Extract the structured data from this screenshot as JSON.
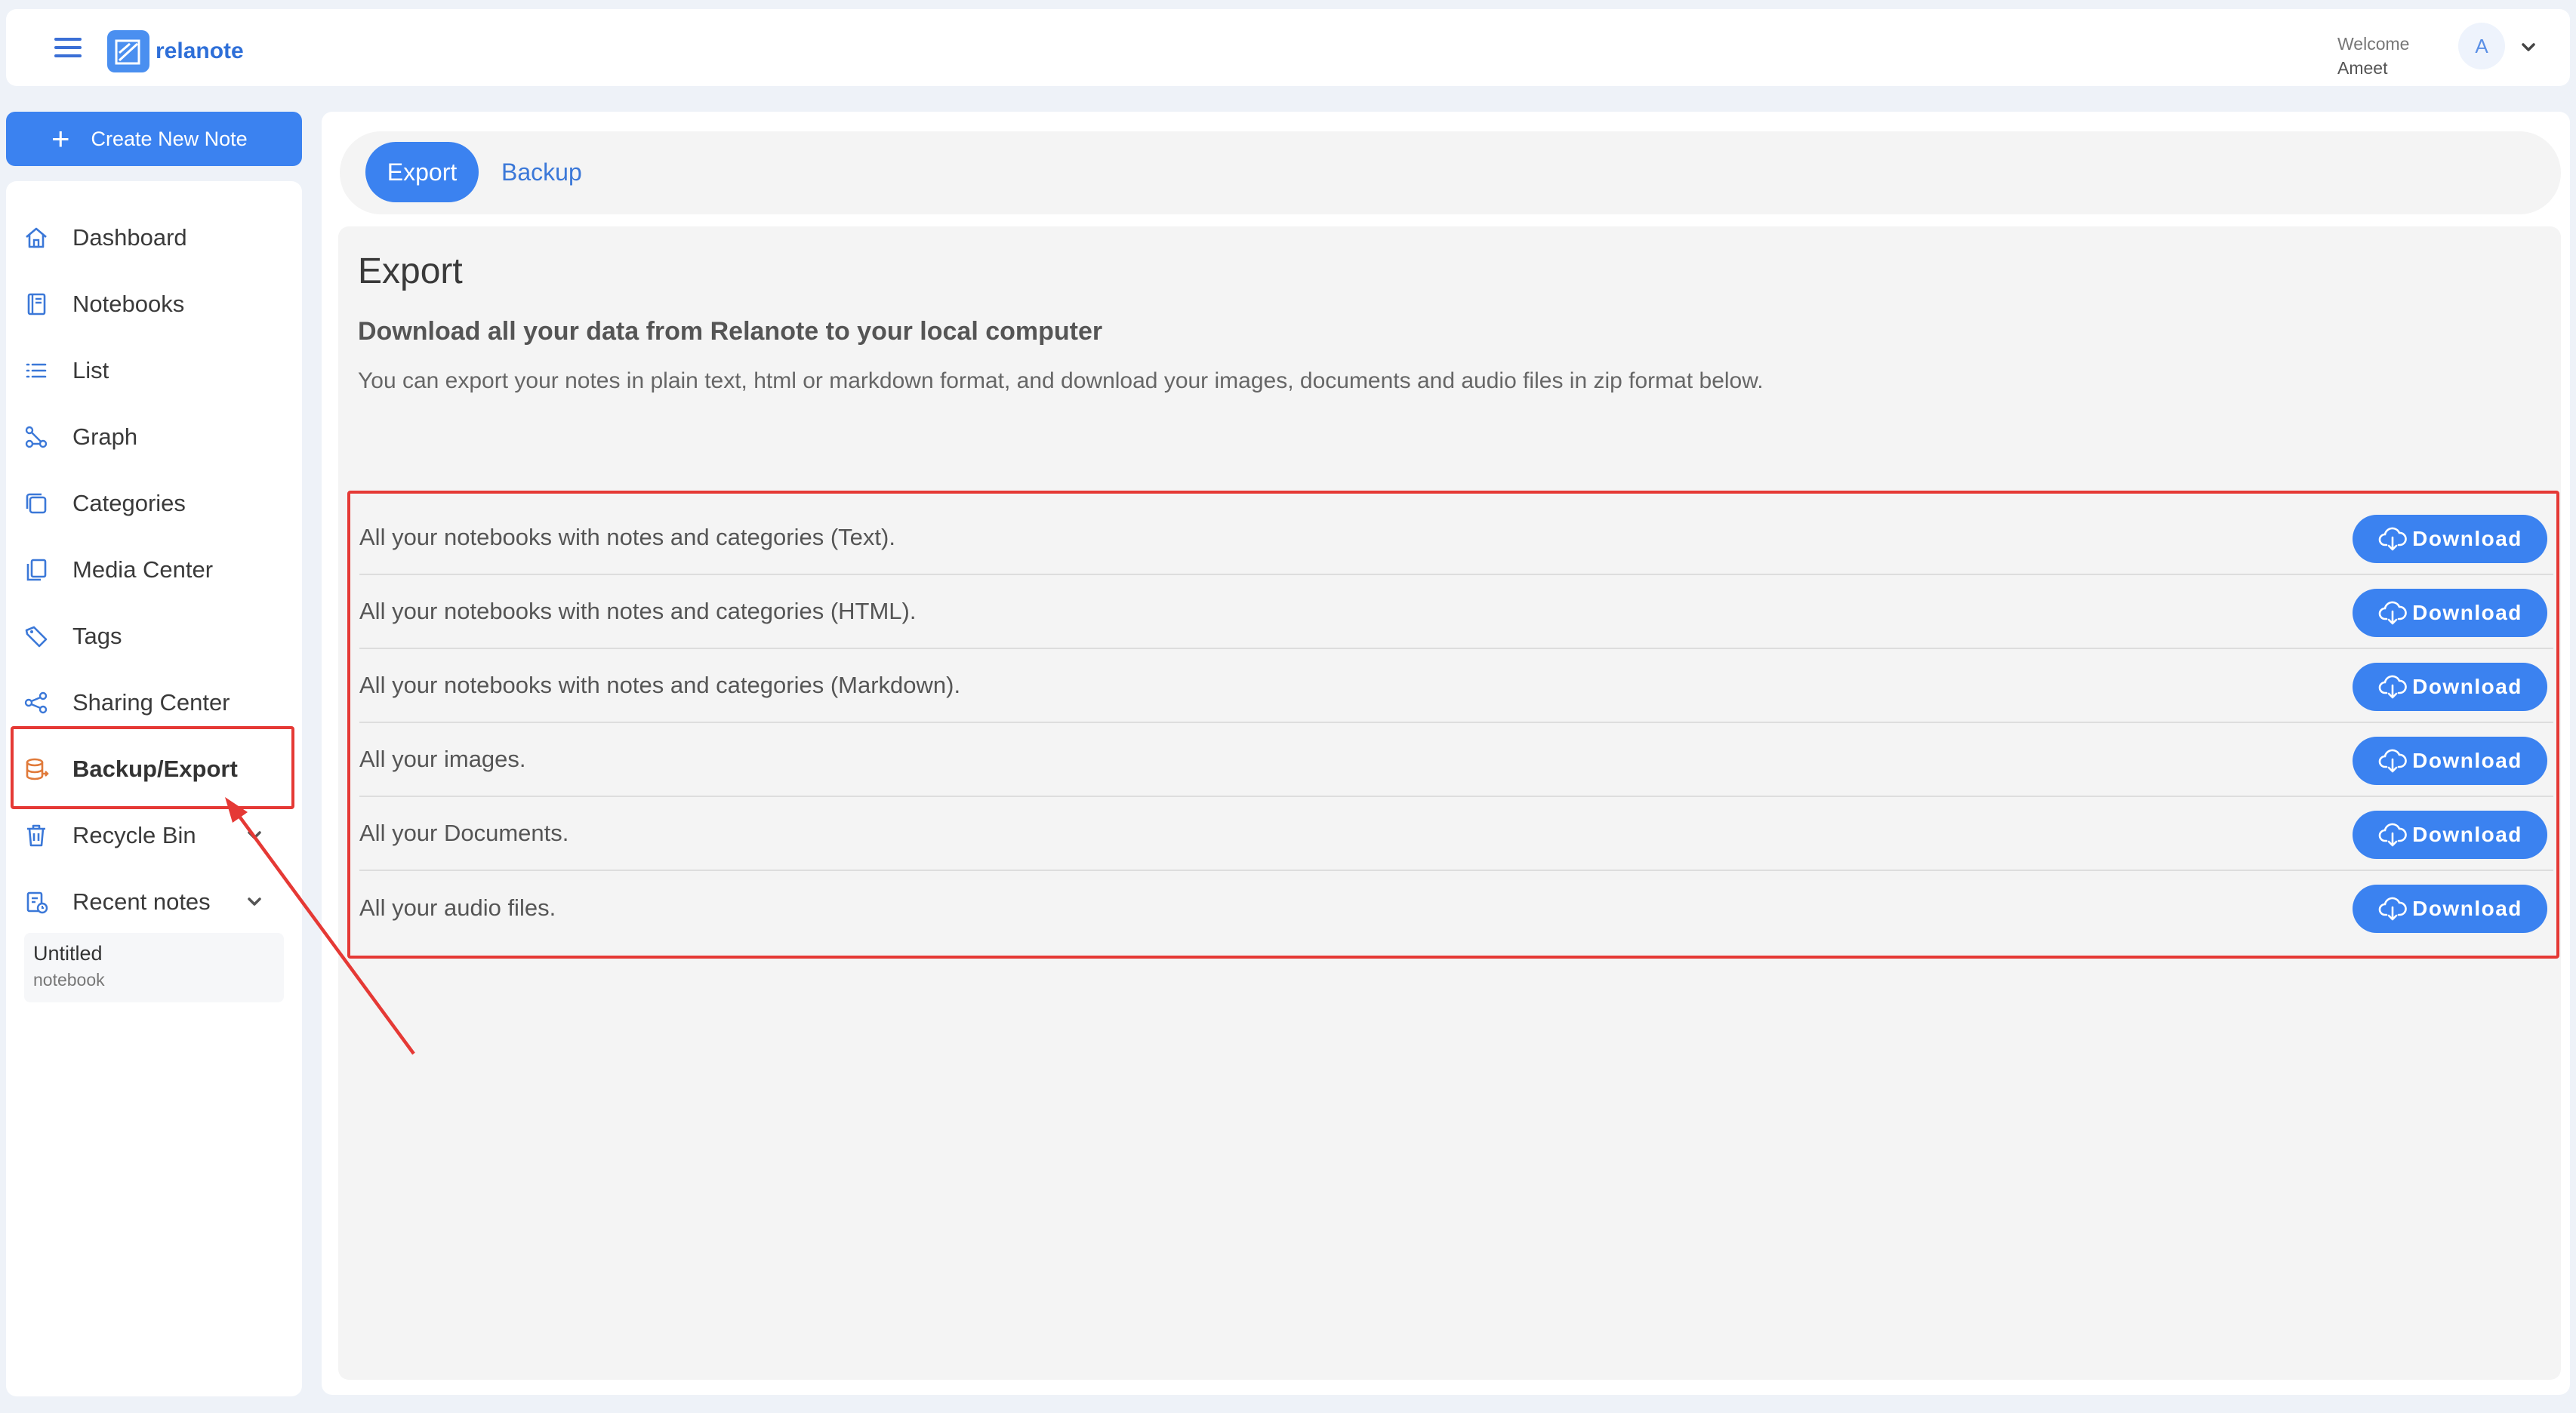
{
  "header": {
    "logo_text": "relanote",
    "welcome_label": "Welcome",
    "user_name": "Ameet",
    "avatar_initial": "A"
  },
  "create_button": {
    "label": "Create New Note"
  },
  "sidebar": {
    "items": [
      {
        "label": "Dashboard",
        "icon": "home-icon"
      },
      {
        "label": "Notebooks",
        "icon": "notebook-icon"
      },
      {
        "label": "List",
        "icon": "list-icon"
      },
      {
        "label": "Graph",
        "icon": "graph-icon"
      },
      {
        "label": "Categories",
        "icon": "categories-icon"
      },
      {
        "label": "Media Center",
        "icon": "media-icon"
      },
      {
        "label": "Tags",
        "icon": "tag-icon"
      },
      {
        "label": "Sharing Center",
        "icon": "share-icon"
      },
      {
        "label": "Backup/Export",
        "icon": "database-icon"
      },
      {
        "label": "Recycle Bin",
        "icon": "trash-icon"
      },
      {
        "label": "Recent notes",
        "icon": "recent-notes-icon"
      }
    ],
    "recent_note": {
      "title": "Untitled",
      "subtitle": "notebook"
    }
  },
  "tabs": {
    "export": "Export",
    "backup": "Backup"
  },
  "export": {
    "title": "Export",
    "subtitle": "Download all your data from Relanote to your local computer",
    "description": "You can export your notes in plain text, html or markdown format, and download your images, documents and audio files in zip format below.",
    "download_label": "Download",
    "rows": [
      "All your notebooks with notes and categories (Text).",
      "All your notebooks with notes and categories (HTML).",
      "All your notebooks with notes and categories (Markdown).",
      "All your images.",
      "All your Documents.",
      "All your audio files."
    ]
  },
  "colors": {
    "accent": "#3b82f0",
    "active_icon": "#e07a3a",
    "annotation_red": "#e53935"
  }
}
